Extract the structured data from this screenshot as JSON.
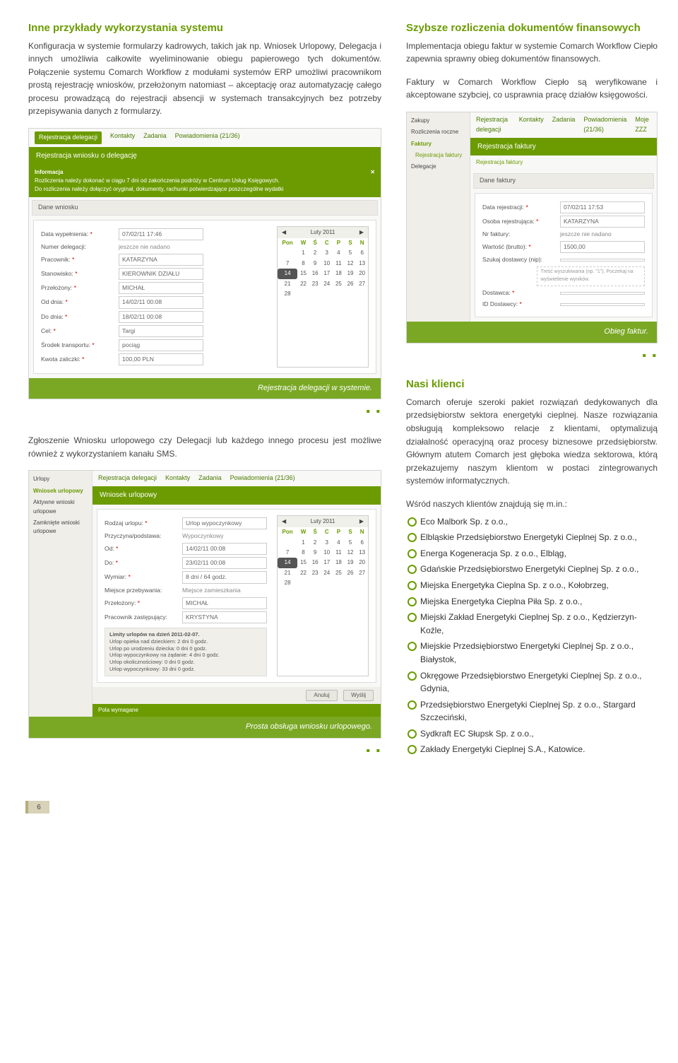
{
  "left": {
    "heading1": "Inne przykłady wykorzystania systemu",
    "para1": "Konfiguracja w systemie formularzy kadrowych, takich jak np. Wniosek Urlopowy, Delegacja i innych umożliwia całkowite wyeliminowanie obiegu papierowego tych dokumentów. Połączenie systemu Comarch Workflow z modułami systemów ERP umożliwi pracownikom prostą rejestrację wniosków, przełożonym natomiast – akceptację oraz automatyzację całego procesu prowadzącą do rejestracji absencji w systemach transakcyjnych bez potrzeby przepisywania danych z formularzy.",
    "fig1": {
      "tabs": [
        "Rejestracja delegacji",
        "Kontakty",
        "Zadania",
        "Powiadomienia (21/36)"
      ],
      "title_bar": "Rejestracja wniosku o delegację",
      "info_heading": "Informacja",
      "info_line1": "Rozliczenia należy dokonać w ciągu 7 dni od zakończenia podróży w Centrum Usług Księgowych.",
      "info_line2": "Do rozliczenia należy dołączyć oryginał, dokumenty, rachunki potwierdzające poszczególne wydatki",
      "dane_label": "Dane wniosku",
      "rows": {
        "data_wyp_l": "Data wypełnienia:",
        "data_wyp_v": "07/02/11 17:46",
        "numer_l": "Numer delegacji:",
        "numer_v": "jeszcze nie nadano",
        "prac_l": "Pracownik:",
        "prac_v": "KATARZYNA",
        "stan_l": "Stanowisko:",
        "stan_v": "KIEROWNIK DZIAŁU",
        "przel_l": "Przełożony:",
        "przel_v": "MICHAŁ",
        "od_l": "Od dnia:",
        "od_v": "14/02/11 00:08",
        "do_l": "Do dnia:",
        "do_v": "18/02/11 00:08",
        "cel_l": "Cel:",
        "cel_v": "Targi",
        "srod_l": "Środek transportu:",
        "srod_v": "pociąg",
        "kwota_l": "Kwota zaliczki:",
        "kwota_v": "100,00 PLN"
      },
      "cal_title": "Luty 2011",
      "cal_dow": [
        "Pon",
        "W",
        "Ś",
        "C",
        "P",
        "S",
        "N"
      ],
      "caption": "Rejestracja delegacji w systemie."
    },
    "para2": "Zgłoszenie Wniosku urlopowego czy Delegacji lub każdego innego procesu jest możliwe również z wykorzystaniem kanału SMS.",
    "fig2": {
      "side_items": [
        "Urlopy",
        "Wniosek urlopowy",
        "Aktywne wnioski urlopowe",
        "Zamknięte wnioski urlopowe"
      ],
      "tabs": [
        "Rejestracja delegacji",
        "Kontakty",
        "Zadania",
        "Powiadomienia (21/36)"
      ],
      "title_bar": "Wniosek urlopowy",
      "rows": {
        "rodzaj_l": "Rodzaj urlopu:",
        "rodzaj_v": "Urlop wypoczynkowy",
        "przy_l": "Przyczyna/podstawa:",
        "przy_v": "Wypoczynkowy",
        "od_l": "Od:",
        "od_v": "14/02/11 00:08",
        "do_l": "Do:",
        "do_v": "23/02/11 00:08",
        "wym_l": "Wymiar:",
        "wym_v": "8 dni / 64 godz.",
        "miejsce_l": "Miejsce przebywania:",
        "miejsce_v": "Miejsce zamieszkania",
        "przel_l": "Przełożony:",
        "przel_v": "MICHAŁ",
        "zast_l": "Pracownik zastępujący:",
        "zast_v": "KRYSTYNA"
      },
      "cal_title": "Luty 2011",
      "summary_title": "Limity urlopów na dzień 2011-02-07.",
      "summary_lines": [
        "Urlop opieka nad dzieckiem: 2 dni 0 godz.",
        "Urlop po urodzeniu dziecka: 0 dni 0 godz.",
        "Urlop wypoczynkowy na żądanie: 4 dni 0 godz.",
        "Urlop okolicznościowy: 0 dni 0 godz.",
        "Urlop wypoczynkowy: 33 dni 0 godz."
      ],
      "btn_cancel": "Anuluj",
      "btn_send": "Wyślij",
      "footer_label": "Pola wymagane",
      "caption": "Prosta obsługa wniosku urlopowego."
    }
  },
  "right": {
    "heading1": "Szybsze rozliczenia dokumentów finansowych",
    "para1": "Implementacja obiegu faktur w systemie Comarch Workflow Ciepło zapewnia sprawny obieg dokumentów finansowych.",
    "para2": "Faktury w Comarch Workflow Ciepło są weryfikowane i akceptowane szybciej, co usprawnia pracę działów księgowości.",
    "fig1": {
      "side_items": [
        "Zakupy",
        "Rozliczenia roczne",
        "Faktury",
        "Rejestracja faktury",
        "Delegacje"
      ],
      "tabs": [
        "Rejestracja delegacji",
        "Kontakty",
        "Zadania",
        "Powiadomienia (21/36)",
        "Moje ZZZ"
      ],
      "title_bar": "Rejestracja faktury",
      "sub_tab": "Rejestracja faktury",
      "dane_label": "Dane faktury",
      "rows": {
        "data_l": "Data rejestracji:",
        "data_v": "07/02/11 17:53",
        "osoba_l": "Osoba rejestrująca:",
        "osoba_v": "KATARZYNA",
        "nr_l": "Nr faktury:",
        "nr_v": "jeszcze nie nadano",
        "wart_l": "Wartość (brutto):",
        "wart_v": "1500,00",
        "szuk_l": "Szukaj dostawcy (nip):",
        "szuk_v": "",
        "hint": "Treść wyszukiwania (np. \"1\"). Poczekaj na wyświetlenie wyników.",
        "dost_l": "Dostawca:",
        "dost_v": "",
        "iddost_l": "ID Dostawcy:",
        "iddost_v": ""
      },
      "caption": "Obieg faktur."
    },
    "heading2": "Nasi klienci",
    "para3": "Comarch oferuje szeroki pakiet rozwiązań dedykowanych dla przedsiębiorstw sektora energetyki cieplnej. Nasze rozwiązania obsługują kompleksowo relacje z klientami, optymalizują działalność operacyjną oraz procesy biznesowe przedsiębiorstw. Głównym atutem Comarch jest głęboka wiedza sektorowa, którą przekazujemy naszym klientom w postaci zintegrowanych systemów informatycznych.",
    "clients_intro": "Wśród naszych klientów znajdują się m.in.:",
    "clients": [
      "Eco Malbork Sp. z o.o.,",
      "Elbląskie Przedsiębiorstwo Energetyki Cieplnej Sp. z o.o.,",
      "Energa Kogeneracja Sp. z o.o., Elbląg,",
      "Gdańskie Przedsiębiorstwo Energetyki Cieplnej Sp. z o.o.,",
      "Miejska Energetyka Cieplna Sp. z o.o., Kołobrzeg,",
      "Miejska Energetyka Cieplna Piła Sp. z o.o.,",
      "Miejski Zakład Energetyki Cieplnej Sp. z o.o., Kędzierzyn-Koźle,",
      "Miejskie Przedsiębiorstwo Energetyki Cieplnej Sp. z o.o., Białystok,",
      "Okręgowe Przedsiębiorstwo Energetyki Cieplnej Sp. z o.o., Gdynia,",
      "Przedsiębiorstwo Energetyki Cieplnej Sp. z o.o., Stargard Szczeciński,",
      "Sydkraft EC Słupsk Sp. z o.o.,",
      "Zakłady Energetyki Cieplnej S.A., Katowice."
    ]
  },
  "page_number": "6"
}
